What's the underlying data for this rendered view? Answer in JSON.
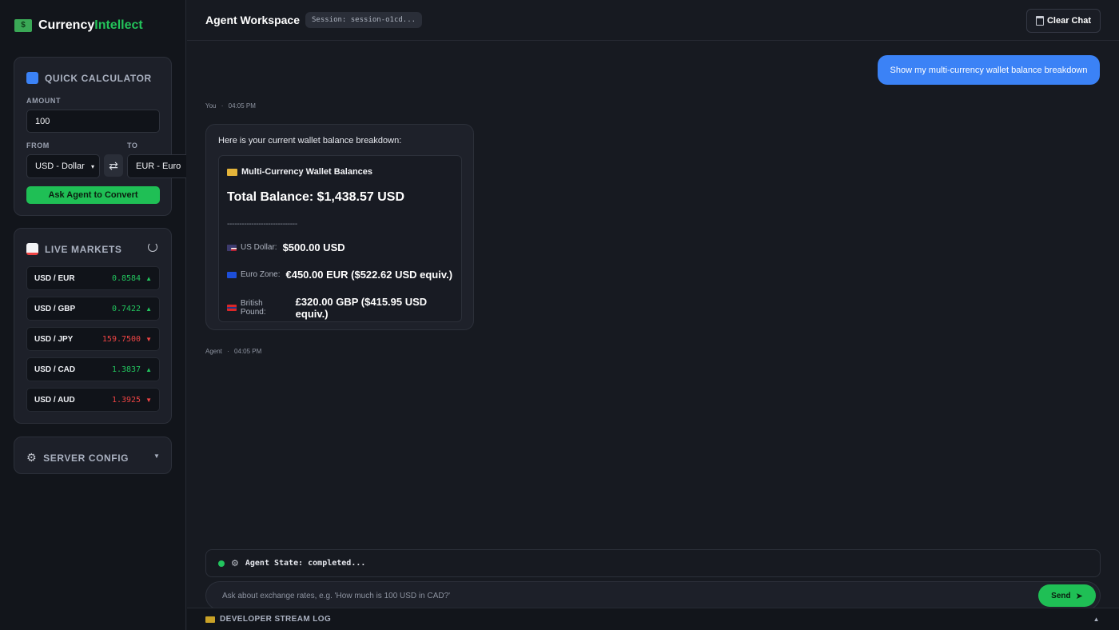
{
  "brand": {
    "part1": "Currency",
    "part2": "Intellect"
  },
  "calculator": {
    "title": "QUICK CALCULATOR",
    "amount_label": "AMOUNT",
    "amount_value": "100",
    "from_label": "FROM",
    "to_label": "TO",
    "from_value": "USD - Dollar",
    "to_value": "EUR - Euro",
    "convert_label": "Ask Agent to Convert"
  },
  "markets": {
    "title": "LIVE MARKETS",
    "rows": [
      {
        "pair": "USD / EUR",
        "rate": "0.8584",
        "dir": "▲"
      },
      {
        "pair": "USD / GBP",
        "rate": "0.7422",
        "dir": "▲"
      },
      {
        "pair": "USD / JPY",
        "rate": "159.7500",
        "dir": "▼"
      },
      {
        "pair": "USD / CAD",
        "rate": "1.3837",
        "dir": "▲"
      },
      {
        "pair": "USD / AUD",
        "rate": "1.3925",
        "dir": "▼"
      }
    ]
  },
  "server_config": {
    "title": "SERVER CONFIG"
  },
  "header": {
    "title": "Agent Workspace",
    "session": "Session: session-o1cd...",
    "clear_label": "Clear Chat"
  },
  "chat": {
    "user_message": "Show my multi-currency wallet balance breakdown",
    "user_meta_name": "You",
    "user_meta_time": "04:05 PM",
    "agent_intro": "Here is your current wallet balance breakdown:",
    "wallet_title": "Multi-Currency Wallet Balances",
    "wallet_total": "Total Balance: $1,438.57 USD",
    "wallet_separator": "-----------------------------",
    "balances": [
      {
        "name": "US Dollar:",
        "value": "$500.00 USD"
      },
      {
        "name": "Euro Zone:",
        "value": "€450.00 EUR ($522.62 USD equiv.)"
      },
      {
        "name": "British Pound:",
        "value": "£320.00 GBP ($415.95 USD equiv.)"
      }
    ],
    "agent_meta_name": "Agent",
    "agent_meta_time": "04:05 PM"
  },
  "agent_state": "Agent State: completed...",
  "input": {
    "placeholder": "Ask about exchange rates, e.g. 'How much is 100 USD in CAD?'",
    "send_label": "Send"
  },
  "log": {
    "title": "DEVELOPER STREAM LOG"
  }
}
